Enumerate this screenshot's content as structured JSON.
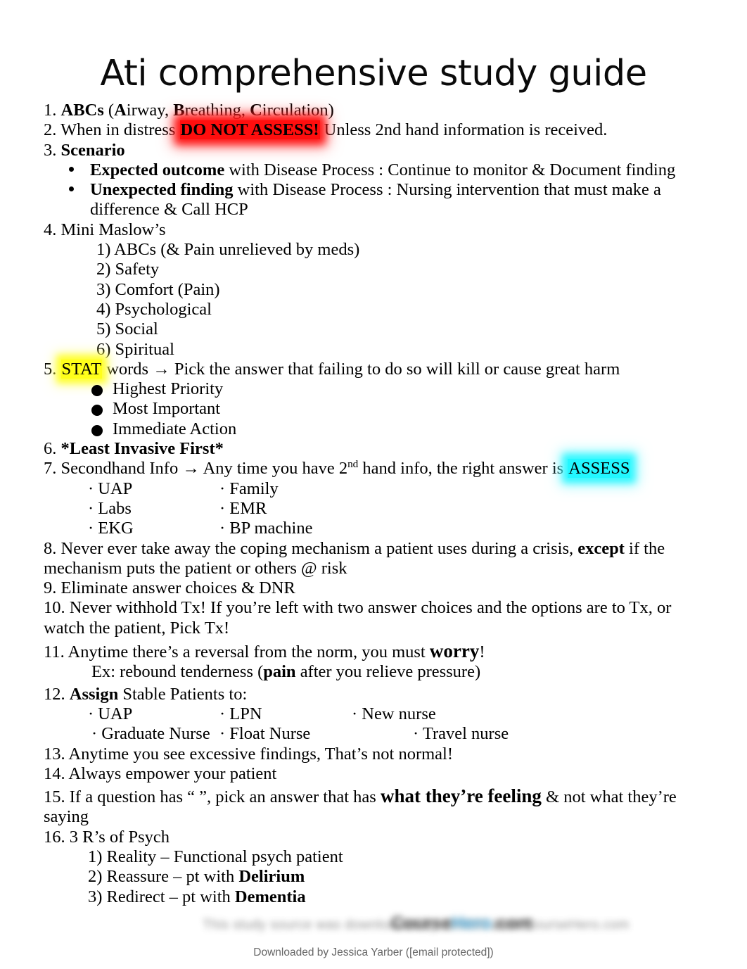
{
  "document": {
    "title": "Ati comprehensive study guide"
  },
  "items": {
    "i1": {
      "num": "1. ",
      "bold1": "ABCs",
      "rest_open": " (",
      "a": "A",
      "airway": "irway, ",
      "b": "B",
      "breathing": "reathing, ",
      "c": "C",
      "circulation": "irculation)"
    },
    "i2": {
      "num": "2. ",
      "pre": "When in distress ",
      "highlight": "DO NOT ASSESS!",
      "post": " Unless 2nd hand information is received."
    },
    "i3": {
      "num": "3. ",
      "bold": "Scenario",
      "bullets": [
        {
          "bold": "Expected outcome",
          "rest": " with Disease Process : Continue to monitor & Document finding"
        },
        {
          "bold": "Unexpected finding",
          "rest": " with Disease Process : Nursing intervention that must make a difference & Call HCP"
        }
      ]
    },
    "i4": {
      "num": "4. ",
      "text": "Mini Maslow’s",
      "sub": [
        "1) ABCs (& Pain unrelieved by meds)",
        "2) Safety",
        "3) Comfort (Pain)",
        "4) Psychological",
        "5) Social",
        "6) Spiritual"
      ]
    },
    "i5": {
      "num": "5. ",
      "highlight": "STAT",
      "rest": " words → Pick the answer that failing to do so will kill or cause great harm",
      "circles": [
        "Highest Priority",
        "Most Important",
        "Immediate Action"
      ]
    },
    "i6": {
      "num": "6. ",
      "bold": "*Least Invasive First*"
    },
    "i7": {
      "num": "7. ",
      "pre": "Secondhand Info → Any time you have 2",
      "sup": "nd",
      "mid": " hand info, the right answer is ",
      "highlight": "ASSESS",
      "rows": [
        {
          "left": "· UAP",
          "right": "· Family"
        },
        {
          "left": "· Labs",
          "right": "· EMR"
        },
        {
          "left": "· EKG",
          "right": "· BP machine"
        }
      ]
    },
    "i8": {
      "num": "8. ",
      "pre": "Never ever take away the coping mechanism a patient uses during a crisis, ",
      "bold": "except",
      "post": " if the mechanism puts the patient or others @ risk"
    },
    "i9": {
      "num": "9. ",
      "text": "Eliminate answer choices & DNR"
    },
    "i10": {
      "num": "10. ",
      "text": "Never withhold Tx! If you’re left with two answer choices and the options are to Tx, or watch the patient, Pick Tx!"
    },
    "i11": {
      "num": "11. ",
      "pre": "Anytime there’s a reversal from the norm, you must ",
      "bold": "worry",
      "post": "!",
      "example_pre": "Ex: rebound tenderness (",
      "example_bold": "pain",
      "example_post": " after you relieve pressure)"
    },
    "i12": {
      "num": "12. ",
      "bold": "Assign",
      "rest": " Stable Patients to:",
      "row1": {
        "c1": "· UAP",
        "c2": "· LPN",
        "c3": "· New nurse"
      },
      "row2": {
        "c1": "· Graduate Nurse",
        "c2": "· Float Nurse",
        "c3": "· Travel nurse"
      }
    },
    "i13": {
      "num": "13. ",
      "text": "Anytime you see excessive findings, That’s not normal!"
    },
    "i14": {
      "num": "14. ",
      "text": "Always empower your patient"
    },
    "i15": {
      "num": "15. ",
      "pre": "If a question has “  ”, pick an answer that has ",
      "bold": "what they’re feeling",
      "post": " & not what they’re saying"
    },
    "i16": {
      "num": "16. ",
      "text": "3 R’s of Psych",
      "sub": [
        {
          "pre": "1) Reality – Functional psych patient",
          "bold": ""
        },
        {
          "pre": "2) Reassure – pt with ",
          "bold": "Delirium"
        },
        {
          "pre": "3) Redirect – pt with ",
          "bold": "Dementia"
        }
      ]
    }
  },
  "footer": {
    "watermark_text": "This study source was downloaded by 100000 from CourseHero.com",
    "watermark_logo_left": "Course",
    "watermark_logo_accent": "Hero",
    "watermark_logo_right": ".com",
    "downloaded_by": "Downloaded by Jessica Yarber ([email protected])"
  },
  "colors": {
    "highlight_red": "#ff0e0e",
    "highlight_yellow": "#ffff1a",
    "highlight_cyan": "#23f7ff",
    "text": "#000000",
    "footer_text": "#666666"
  }
}
